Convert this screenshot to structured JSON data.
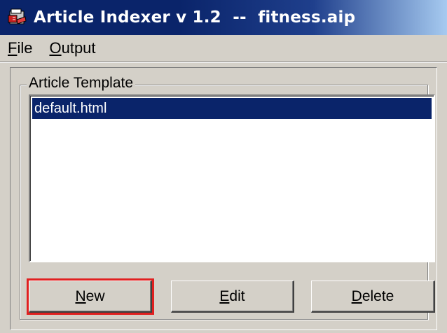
{
  "window": {
    "title": "Article Indexer v 1.2  --  fitness.aip",
    "app_icon": "article-indexer-app-icon"
  },
  "menu": {
    "items": [
      {
        "accel": "F",
        "rest": "ile"
      },
      {
        "accel": "O",
        "rest": "utput"
      }
    ]
  },
  "group": {
    "label": "Article Template"
  },
  "list": {
    "items": [
      "default.html"
    ],
    "selected_index": 0
  },
  "buttons": {
    "new": {
      "accel": "N",
      "rest": "ew"
    },
    "edit": {
      "accel": "E",
      "rest": "dit"
    },
    "delete": {
      "accel": "D",
      "rest": "elete"
    }
  },
  "colors": {
    "title_bar": "#0a246a",
    "selection": "#0a246a",
    "face": "#d4d0c8",
    "highlight_box": "#e02020"
  }
}
